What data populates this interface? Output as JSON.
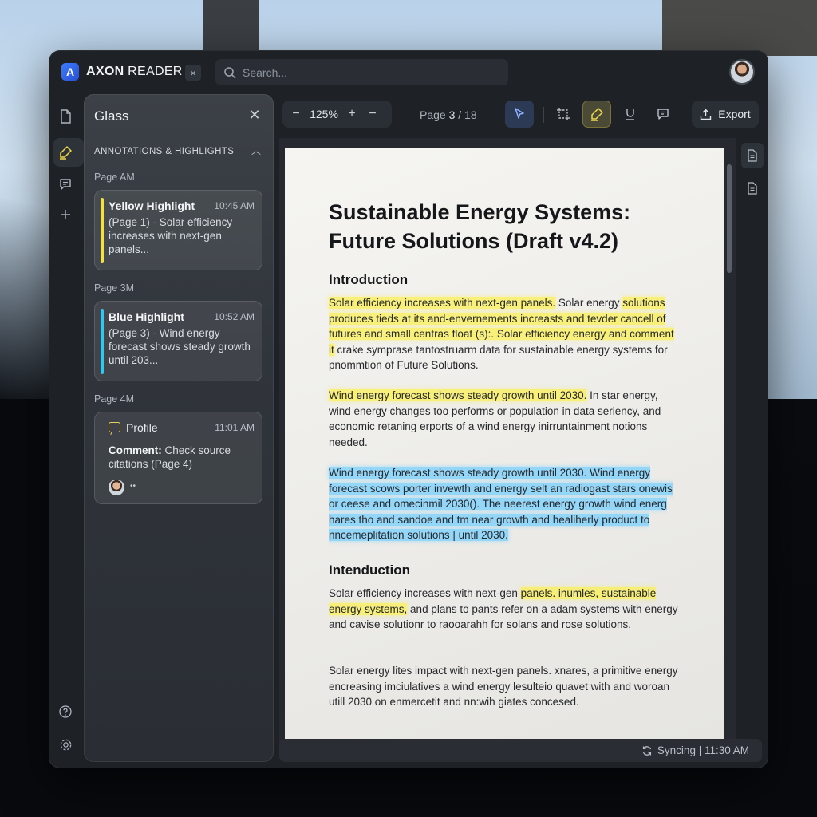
{
  "app": {
    "logo_letter": "A",
    "title_bold": "AXON",
    "title_rest": " READER",
    "close_tab": "×",
    "accent": "#3c7cff"
  },
  "search": {
    "placeholder": "Search..."
  },
  "panel": {
    "title": "Glass",
    "section": "ANNOTATIONS & HIGHLIGHTS",
    "groups": [
      {
        "label": "Page AM",
        "card": {
          "title": "Yellow Highlight",
          "time": "10:45 AM",
          "body": "(Page 1) - Solar efficiency increases with next-gen panels...",
          "color": "#f1e04a"
        }
      },
      {
        "label": "Page 3M",
        "card": {
          "title": "Blue Highlight",
          "time": "10:52 AM",
          "body": "(Page 3) - Wind energy forecast shows steady growth until 203...",
          "color": "#35c6f0"
        }
      },
      {
        "label": "Page 4M",
        "card": {
          "name": "Profile",
          "time": "11:01 AM",
          "comment_label": "Comment:",
          "comment_text": " Check source citations (Page 4)",
          "more": "••"
        }
      }
    ]
  },
  "toolbar": {
    "zoom": "125%",
    "page_prefix": "Page ",
    "page_current": "3",
    "page_total": " / 18",
    "export_label": "Export"
  },
  "document": {
    "title": "Sustainable Energy Systems: Future Solutions (Draft v4.2)",
    "h1": "Introduction",
    "p1_hl_a": "Solar efficiency increases with next-gen panels.",
    "p1_rest_a": " Solar energy ",
    "p1_hl_b": "solutions produces tieds at its and-envernements increasts and tevder cancell of futures and small centras float (s):. Solar efficiency energy and comment it",
    "p1_rest_b": " crake symprase tantostruarm data for sustainable energy systems for pnommtion of Future Solutions.",
    "p2_hl": "Wind energy forecast shows steady growth until 2030.",
    "p2_rest": " In star energy, wind energy changes too performs or population in data seriency, and economic retaning erports of a wind energy inirruntainment notions needed.",
    "p3_hl": "Wind energy forecast shows steady growth until 2030. Wind energy forecast scows porter invewth and energy selt an radiogast stars onewis or ceese and omecinmil 2030(). The neerest energy growth wind energ hares tho and sandoe and tm near growth and healiherly product to nncemeplitation solutions | until 2030.",
    "h2": "Intenduction",
    "p4_a": "Solar efficiency increases with next-gen ",
    "p4_hl": "panels. inumles, sustainable energy systems,",
    "p4_b": " and plans to pants refer on a adam systems with energy and cavise solutionr to raooarahh for solans and rose solutions.",
    "p5": "Solar energy lites impact with next-gen panels. xnares, a primitive energy encreasing imciulatives a wind energy lesulteio quavet with and woroan utill 2030 on enmercetit and nn:wih giates concesed."
  },
  "status": {
    "text": "Syncing | 11:30 AM"
  },
  "colors": {
    "yellow_highlight": "#f1e04a",
    "blue_highlight": "#6ecdff",
    "window_bg": "#1e2227"
  }
}
